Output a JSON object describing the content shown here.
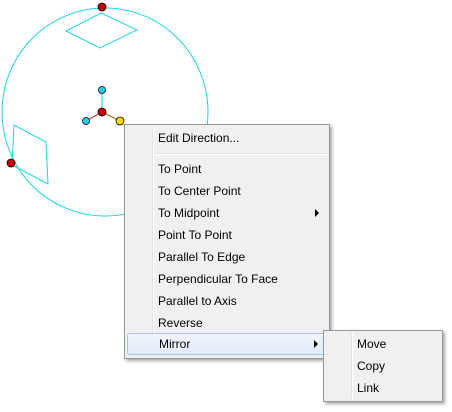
{
  "context_menu": {
    "items": [
      {
        "label": "Edit Direction..."
      },
      {
        "label": "To Point"
      },
      {
        "label": "To Center Point"
      },
      {
        "label": "To Midpoint"
      },
      {
        "label": "Point To Point"
      },
      {
        "label": "Parallel To Edge"
      },
      {
        "label": "Perpendicular To Face"
      },
      {
        "label": "Parallel to Axis"
      },
      {
        "label": "Reverse"
      },
      {
        "label": "Mirror"
      }
    ]
  },
  "submenu": {
    "items": [
      {
        "label": "Move"
      },
      {
        "label": "Copy"
      },
      {
        "label": "Link"
      }
    ]
  },
  "colors": {
    "wireframe": "#1ed2e6",
    "handle_red": "#c80000",
    "handle_cyan": "#1ed2e6",
    "handle_yellow": "#ffd800",
    "menu_bg": "#f0f0f0",
    "highlight_border": "#a8c4e6"
  }
}
